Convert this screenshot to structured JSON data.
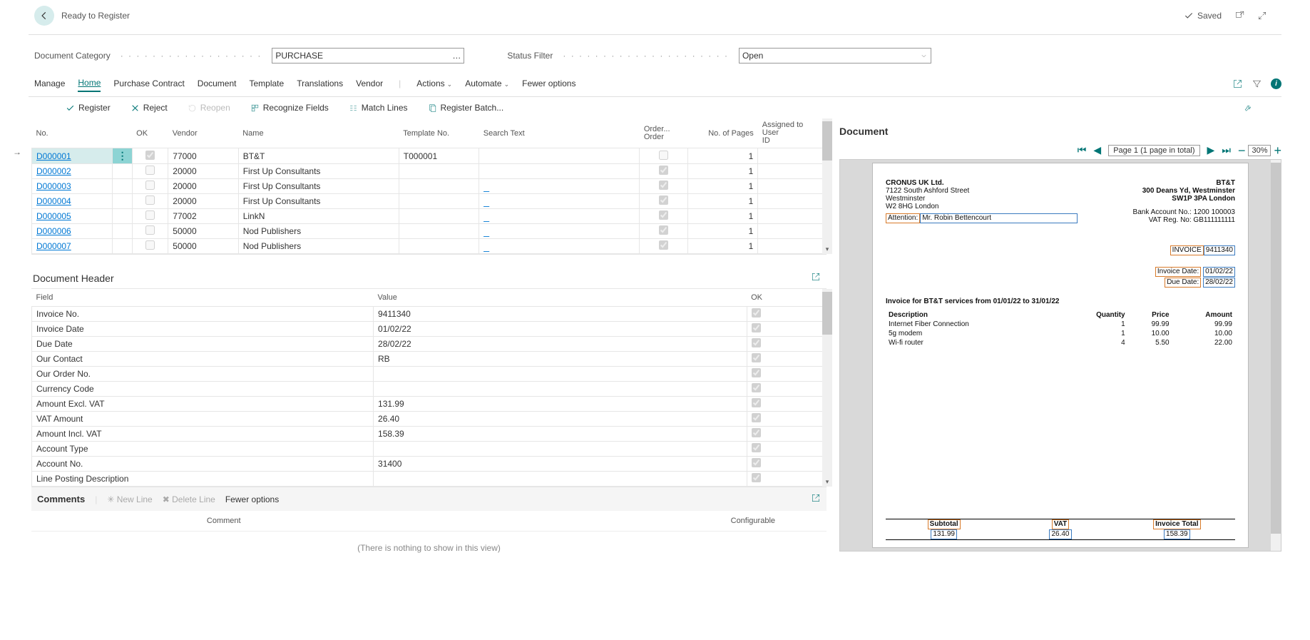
{
  "page_title": "Ready to Register",
  "saved_label": "Saved",
  "filters": {
    "doc_category_label": "Document Category",
    "doc_category_value": "PURCHASE",
    "status_label": "Status Filter",
    "status_value": "Open"
  },
  "tabs": [
    "Manage",
    "Home",
    "Purchase Contract",
    "Document",
    "Template",
    "Translations",
    "Vendor",
    "Actions",
    "Automate",
    "Fewer options"
  ],
  "actions": {
    "register": "Register",
    "reject": "Reject",
    "reopen": "Reopen",
    "recognize": "Recognize Fields",
    "match": "Match Lines",
    "batch": "Register Batch..."
  },
  "grid_cols": {
    "no": "No.",
    "ok": "OK",
    "vendor": "Vendor",
    "name": "Name",
    "template": "Template No.",
    "search": "Search Text",
    "order": "Order...\nOrder",
    "pages": "No. of Pages",
    "assigned": "Assigned to User ID"
  },
  "rows": [
    {
      "no": "D000001",
      "ok": true,
      "vendor": "77000",
      "name": "BT&T",
      "template": "T000001",
      "search": "",
      "order": "",
      "pages": "1",
      "assigned": ""
    },
    {
      "no": "D000002",
      "ok": false,
      "vendor": "20000",
      "name": "First Up Consultants",
      "template": "",
      "search": "",
      "order": "",
      "pages": "1",
      "assigned": ""
    },
    {
      "no": "D000003",
      "ok": false,
      "vendor": "20000",
      "name": "First Up Consultants",
      "template": "",
      "search": "_",
      "order": "",
      "pages": "1",
      "assigned": ""
    },
    {
      "no": "D000004",
      "ok": false,
      "vendor": "20000",
      "name": "First Up Consultants",
      "template": "",
      "search": "_",
      "order": "",
      "pages": "1",
      "assigned": ""
    },
    {
      "no": "D000005",
      "ok": false,
      "vendor": "77002",
      "name": "LinkN",
      "template": "",
      "search": "_",
      "order": "",
      "pages": "1",
      "assigned": ""
    },
    {
      "no": "D000006",
      "ok": false,
      "vendor": "50000",
      "name": "Nod Publishers",
      "template": "",
      "search": "_",
      "order": "",
      "pages": "1",
      "assigned": ""
    },
    {
      "no": "D000007",
      "ok": false,
      "vendor": "50000",
      "name": "Nod Publishers",
      "template": "",
      "search": "_",
      "order": "",
      "pages": "1",
      "assigned": ""
    }
  ],
  "header": {
    "title": "Document Header",
    "field_col": "Field",
    "value_col": "Value",
    "ok_col": "OK",
    "rows": [
      {
        "f": "Invoice No.",
        "v": "9411340",
        "ok": true
      },
      {
        "f": "Invoice Date",
        "v": "01/02/22",
        "ok": true
      },
      {
        "f": "Due Date",
        "v": "28/02/22",
        "ok": true
      },
      {
        "f": "Our Contact",
        "v": "RB",
        "ok": true
      },
      {
        "f": "Our Order No.",
        "v": "",
        "ok": true
      },
      {
        "f": "Currency Code",
        "v": "",
        "ok": true
      },
      {
        "f": "Amount Excl. VAT",
        "v": "131.99",
        "ok": true
      },
      {
        "f": "VAT Amount",
        "v": "26.40",
        "ok": true
      },
      {
        "f": "Amount Incl. VAT",
        "v": "158.39",
        "ok": true
      },
      {
        "f": "Account Type",
        "v": "",
        "ok": true
      },
      {
        "f": "Account No.",
        "v": "31400",
        "ok": true
      },
      {
        "f": "Line Posting Description",
        "v": "",
        "ok": true
      }
    ]
  },
  "comments": {
    "title": "Comments",
    "new": "New Line",
    "delete": "Delete Line",
    "fewer": "Fewer options",
    "col1": "Comment",
    "col2": "Configurable",
    "empty": "(There is nothing to show in this view)"
  },
  "doc": {
    "title": "Document",
    "page_indicator": "Page 1 (1 page in total)",
    "zoom": "30%",
    "seller": {
      "name": "CRONUS UK Ltd.",
      "addr1": "7122 South Ashford Street",
      "addr2": "Westminster",
      "addr3": "W2 8HG London"
    },
    "buyer": {
      "name": "BT&T",
      "addr1": "300 Deans Yd, Westminster",
      "addr2": "SW1P 3PA London",
      "bank": "Bank Account No.: 1200 100003",
      "vat": "VAT Reg. No: GB111111111"
    },
    "attention_label": "Attention:",
    "attention_value": "Mr. Robin Bettencourt",
    "invoice_label": "INVOICE",
    "invoice_no": "9411340",
    "invoice_date_label": "Invoice Date:",
    "invoice_date": "01/02/22",
    "due_date_label": "Due Date:",
    "due_date": "28/02/22",
    "subtitle": "Invoice for BT&T services from 01/01/22 to 31/01/22",
    "cols": {
      "desc": "Description",
      "qty": "Quantity",
      "price": "Price",
      "amount": "Amount"
    },
    "lines": [
      {
        "d": "Internet Fiber Connection",
        "q": "1",
        "p": "99.99",
        "a": "99.99"
      },
      {
        "d": "5g modem",
        "q": "1",
        "p": "10.00",
        "a": "10.00"
      },
      {
        "d": "Wi-fi router",
        "q": "4",
        "p": "5.50",
        "a": "22.00"
      }
    ],
    "totals": {
      "subtotal_l": "Subtotal",
      "subtotal": "131.99",
      "vat_l": "VAT",
      "vat": "26.40",
      "total_l": "Invoice Total",
      "total": "158.39"
    }
  }
}
